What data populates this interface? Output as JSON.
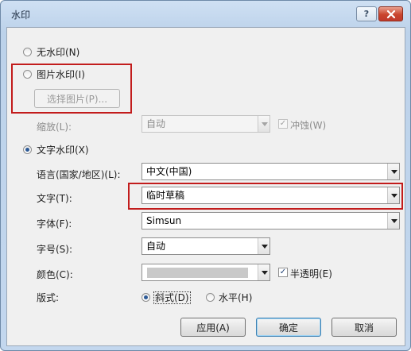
{
  "window": {
    "title": "水印",
    "help_label": "?"
  },
  "options": {
    "no_watermark": "无水印(N)",
    "picture_watermark": "图片水印(I)",
    "select_picture_label": "选择图片(P)...",
    "scale_label": "缩放(L):",
    "scale_value": "自动",
    "washout_label": "冲蚀(W)",
    "text_watermark": "文字水印(X)"
  },
  "text_settings": {
    "language_label": "语言(国家/地区)(L):",
    "language_value": "中文(中国)",
    "text_label": "文字(T):",
    "text_value": "临时草稿",
    "font_label": "字体(F):",
    "font_value": "Simsun",
    "size_label": "字号(S):",
    "size_value": "自动",
    "color_label": "颜色(C):",
    "color_value": "#c9c9c9",
    "semitransparent_label": "半透明(E)",
    "layout_label": "版式:",
    "diagonal_label": "斜式(D)",
    "horizontal_label": "水平(H)"
  },
  "buttons": {
    "apply": "应用(A)",
    "ok": "确定",
    "cancel": "取消"
  }
}
